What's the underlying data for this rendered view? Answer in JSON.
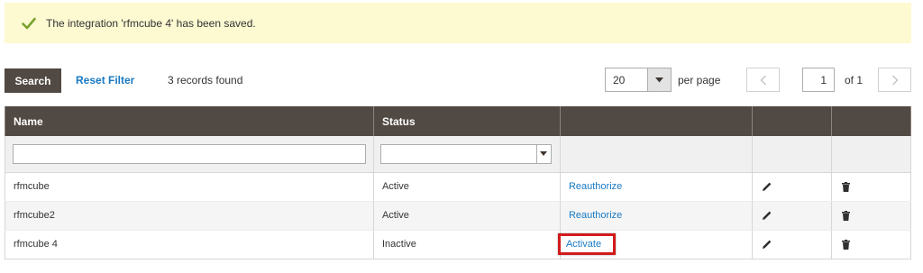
{
  "message": {
    "icon": "checkmark-icon",
    "text": "The integration 'rfmcube 4' has been saved.",
    "background_color": "#fdf9d1",
    "icon_color": "#79a22e"
  },
  "toolbar": {
    "search_label": "Search",
    "reset_filter_label": "Reset Filter",
    "records_found": "3 records found",
    "per_page_value": "20",
    "per_page_label": "per page",
    "current_page": "1",
    "page_total": "of 1"
  },
  "grid": {
    "columns": [
      "Name",
      "Status",
      "",
      "",
      ""
    ],
    "filters": {
      "name_value": "",
      "status_value": ""
    },
    "rows": [
      {
        "name": "rfmcube",
        "status": "Active",
        "action": "Reauthorize"
      },
      {
        "name": "rfmcube2",
        "status": "Active",
        "action": "Reauthorize"
      },
      {
        "name": "rfmcube 4",
        "status": "Inactive",
        "action": "Activate"
      }
    ],
    "edit_icon": "pencil-icon",
    "delete_icon": "trash-icon"
  },
  "colors": {
    "header_bg": "#514943",
    "link": "#1979c3",
    "highlight_border": "#d21b1b"
  }
}
